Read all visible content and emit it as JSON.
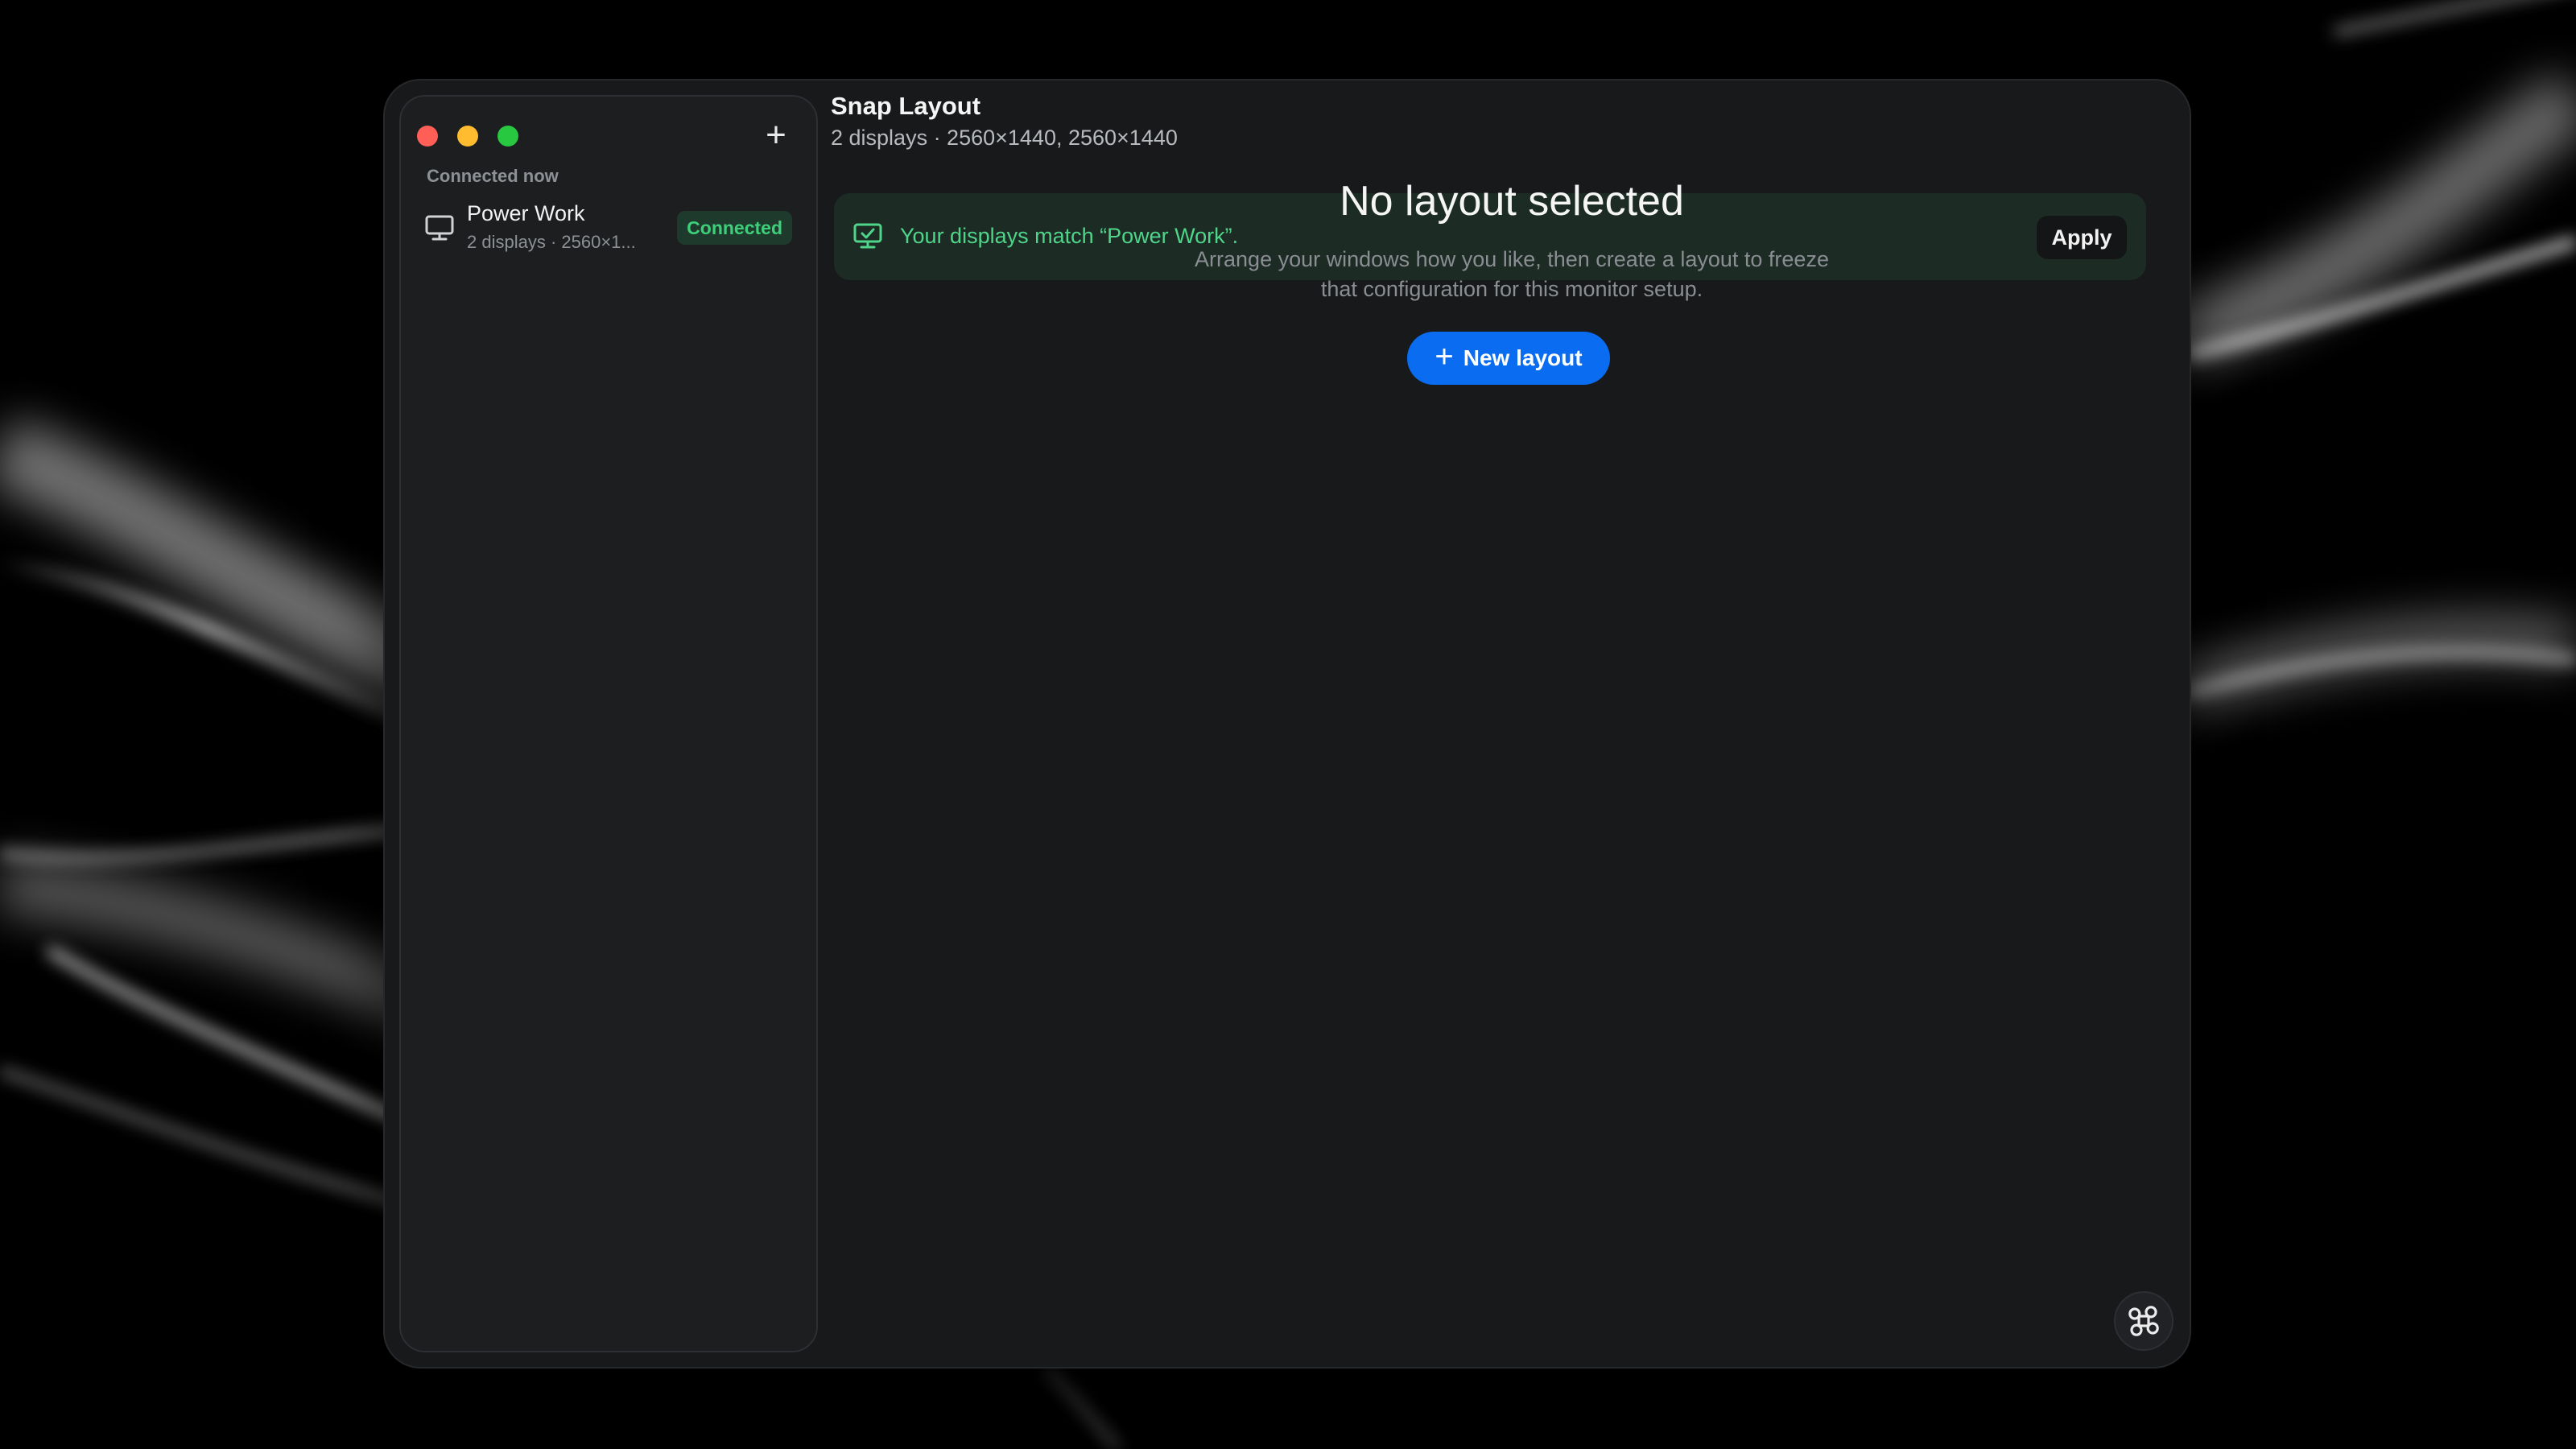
{
  "colors": {
    "traffic_close": "#ff5f57",
    "traffic_minimize": "#febc2e",
    "traffic_maximize": "#28c840",
    "accent_blue": "#0a6cf0",
    "success_green": "#3ecf7a"
  },
  "sidebar": {
    "add_icon": "plus-icon",
    "section_label": "Connected now",
    "items": [
      {
        "icon": "monitor-icon",
        "title": "Power Work",
        "subtitle": "2 displays · 2560×1...",
        "badge": "Connected"
      }
    ]
  },
  "main": {
    "title": "Snap Layout",
    "subtitle": "2 displays · 2560×1440, 2560×1440",
    "banner": {
      "icon": "monitor-check-icon",
      "text": "Your displays match “Power Work”.",
      "apply_label": "Apply"
    },
    "empty_state": {
      "title": "No layout selected",
      "description": "Arrange your windows how you like, then create a layout to freeze that configuration for this monitor setup.",
      "button_label": "New layout"
    },
    "corner_icon": "command-icon"
  }
}
